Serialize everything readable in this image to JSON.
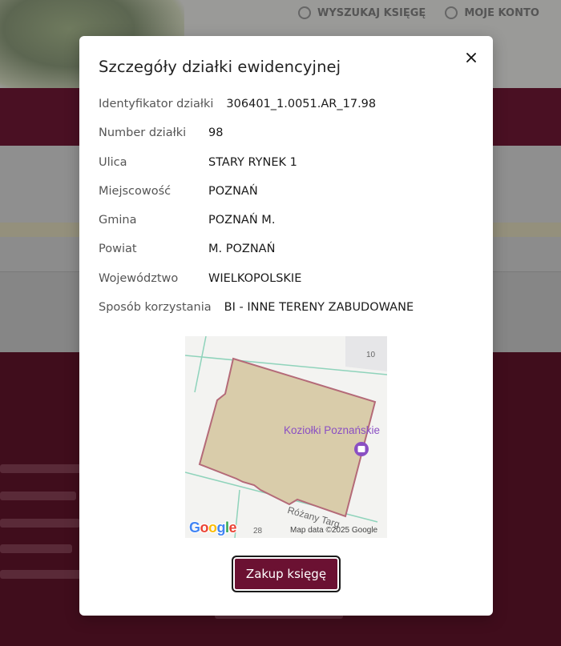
{
  "background": {
    "top_nav": [
      {
        "label": "WYSZUKAJ KSIĘGĘ",
        "icon": "search-icon"
      },
      {
        "label": "MOJE KONTO",
        "icon": "user-icon"
      }
    ]
  },
  "modal": {
    "title": "Szczegóły działki ewidencyjnej",
    "close_icon": "close-icon",
    "fields": [
      {
        "label": "Identyfikator działki",
        "value": "306401_1.0051.AR_17.98"
      },
      {
        "label": "Number działki",
        "value": "98"
      },
      {
        "label": "Ulica",
        "value": "STARY RYNEK 1"
      },
      {
        "label": "Miejscowość",
        "value": "POZNAŃ"
      },
      {
        "label": "Gmina",
        "value": "POZNAŃ M."
      },
      {
        "label": "Powiat",
        "value": "M. POZNAŃ"
      },
      {
        "label": "Województwo",
        "value": "WIELKOPOLSKIE"
      },
      {
        "label": "Sposób korzystania",
        "value": "BI - INNE TERENY ZABUDOWANE"
      }
    ],
    "map": {
      "place_label": "Koziołki Poznańskie",
      "street_label": "Różany Targ",
      "building_number_top": "10",
      "building_number_bottom": "28",
      "copyright": "Map data ©2025 Google",
      "logo_letters": [
        "G",
        "o",
        "o",
        "g",
        "l",
        "e"
      ],
      "parcel_fill": "#d9ccaa",
      "parcel_stroke": "#b46a78",
      "road_color": "#8fd3bb"
    },
    "buy_button_label": "Zakup księgę"
  },
  "colors": {
    "brand": "#6b1132",
    "footer": "#400d1c",
    "place_label": "#8a4fc3"
  }
}
